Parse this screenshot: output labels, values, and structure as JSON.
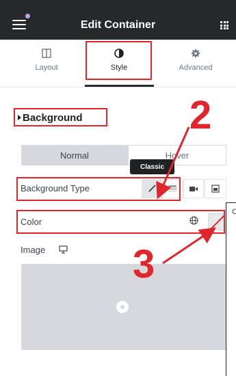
{
  "header": {
    "title": "Edit Container",
    "menu_icon": "hamburger-icon",
    "grid_icon": "grid-icon"
  },
  "tabs": [
    {
      "label": "Layout",
      "icon": "layout-columns-icon"
    },
    {
      "label": "Style",
      "icon": "half-circle-icon",
      "active": true
    },
    {
      "label": "Advanced",
      "icon": "gear-icon"
    }
  ],
  "section": {
    "title": "Background"
  },
  "state_toggle": {
    "normal_label": "Normal",
    "hover_label": "Hover"
  },
  "tooltip": {
    "text": "Classic"
  },
  "background_type": {
    "label": "Background Type",
    "options": [
      "classic-brush-icon",
      "gradient-icon",
      "video-icon",
      "slideshow-icon"
    ]
  },
  "color": {
    "label": "Color",
    "globe_icon": "globe-icon"
  },
  "image": {
    "label": "Image",
    "device_icon": "monitor-icon"
  },
  "popup": {
    "partial_text": "C"
  },
  "annotations": {
    "step_2": "2",
    "step_3": "3",
    "color": "#e0262c"
  }
}
